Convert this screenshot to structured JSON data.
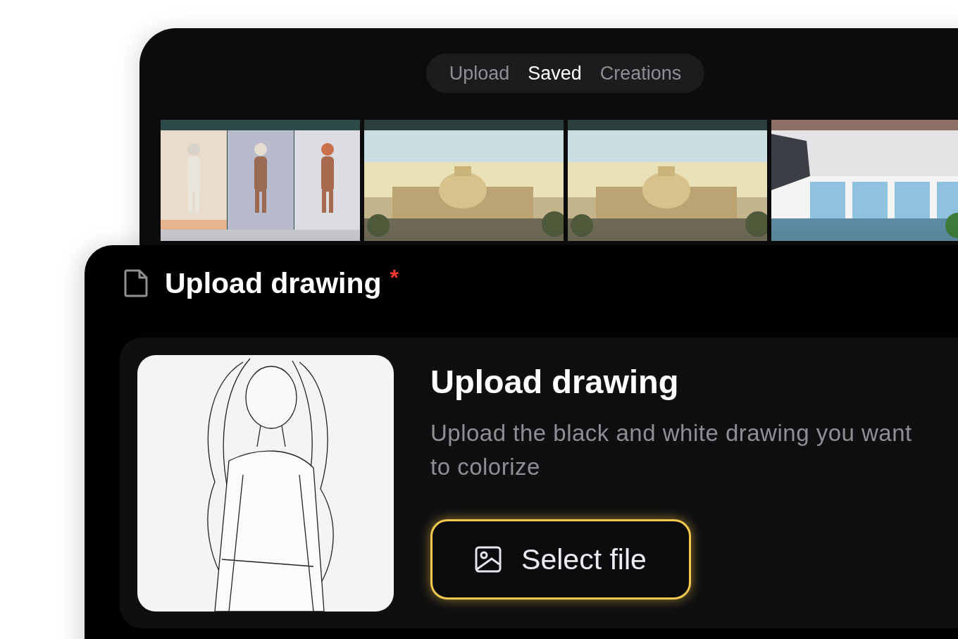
{
  "library": {
    "tabs": [
      {
        "label": "Upload",
        "selected": false
      },
      {
        "label": "Saved",
        "selected": true
      },
      {
        "label": "Creations",
        "selected": false
      }
    ]
  },
  "upload_section": {
    "title": "Upload drawing",
    "required_mark": "*",
    "card": {
      "heading": "Upload drawing",
      "description": "Upload the black and white drawing you want to colorize",
      "button": {
        "label": "Select file"
      }
    }
  }
}
